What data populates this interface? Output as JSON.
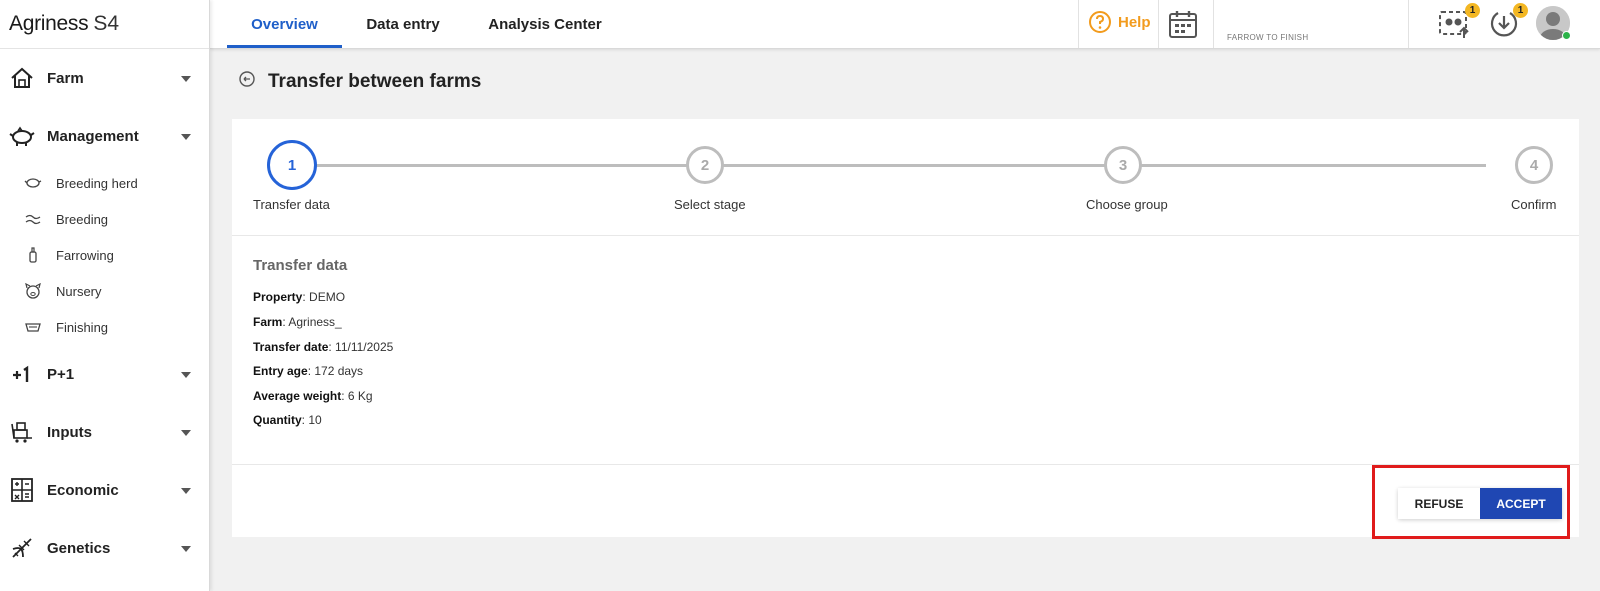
{
  "brand": {
    "name": "Agriness",
    "product": "S4"
  },
  "sidebar": {
    "groups": [
      {
        "label": "Farm",
        "icon": "home-icon"
      },
      {
        "label": "Management",
        "icon": "pig-icon"
      },
      {
        "label": "P+1",
        "icon": "plus-one-icon"
      },
      {
        "label": "Inputs",
        "icon": "cart-icon"
      },
      {
        "label": "Economic",
        "icon": "calculator-icon"
      },
      {
        "label": "Genetics",
        "icon": "dna-icon"
      }
    ],
    "management_items": [
      {
        "label": "Breeding herd",
        "icon": "sow-icon"
      },
      {
        "label": "Breeding",
        "icon": "breeding-icon"
      },
      {
        "label": "Farrowing",
        "icon": "bottle-icon"
      },
      {
        "label": "Nursery",
        "icon": "piglet-icon"
      },
      {
        "label": "Finishing",
        "icon": "feeder-icon"
      }
    ]
  },
  "topbar": {
    "tabs": [
      {
        "label": "Overview",
        "active": true
      },
      {
        "label": "Data entry",
        "active": false
      },
      {
        "label": "Analysis Center",
        "active": false
      }
    ],
    "help_label": "Help",
    "production_type": "FARROW TO FINISH",
    "notifications": {
      "upload_count": "1",
      "download_count": "1"
    }
  },
  "page": {
    "title": "Transfer between farms"
  },
  "stepper": {
    "steps": [
      {
        "number": "1",
        "label": "Transfer data",
        "active": true
      },
      {
        "number": "2",
        "label": "Select stage",
        "active": false
      },
      {
        "number": "3",
        "label": "Choose group",
        "active": false
      },
      {
        "number": "4",
        "label": "Confirm",
        "active": false
      }
    ]
  },
  "transfer": {
    "section_title": "Transfer data",
    "fields": [
      {
        "key": "Property",
        "value": ": DEMO"
      },
      {
        "key": "Farm",
        "value": ": Agriness_"
      },
      {
        "key": "Transfer date",
        "value": ": 11/11/2025"
      },
      {
        "key": "Entry age",
        "value": ": 172 days"
      },
      {
        "key": "Average weight",
        "value": ": 6 Kg"
      },
      {
        "key": "Quantity",
        "value": ": 10"
      }
    ]
  },
  "actions": {
    "refuse_label": "REFUSE",
    "accept_label": "ACCEPT"
  },
  "colors": {
    "primary": "#1f5fc9",
    "accept": "#1f47b3",
    "help": "#f29b1d",
    "badge": "#f3b723",
    "highlight": "#e01b1b"
  }
}
